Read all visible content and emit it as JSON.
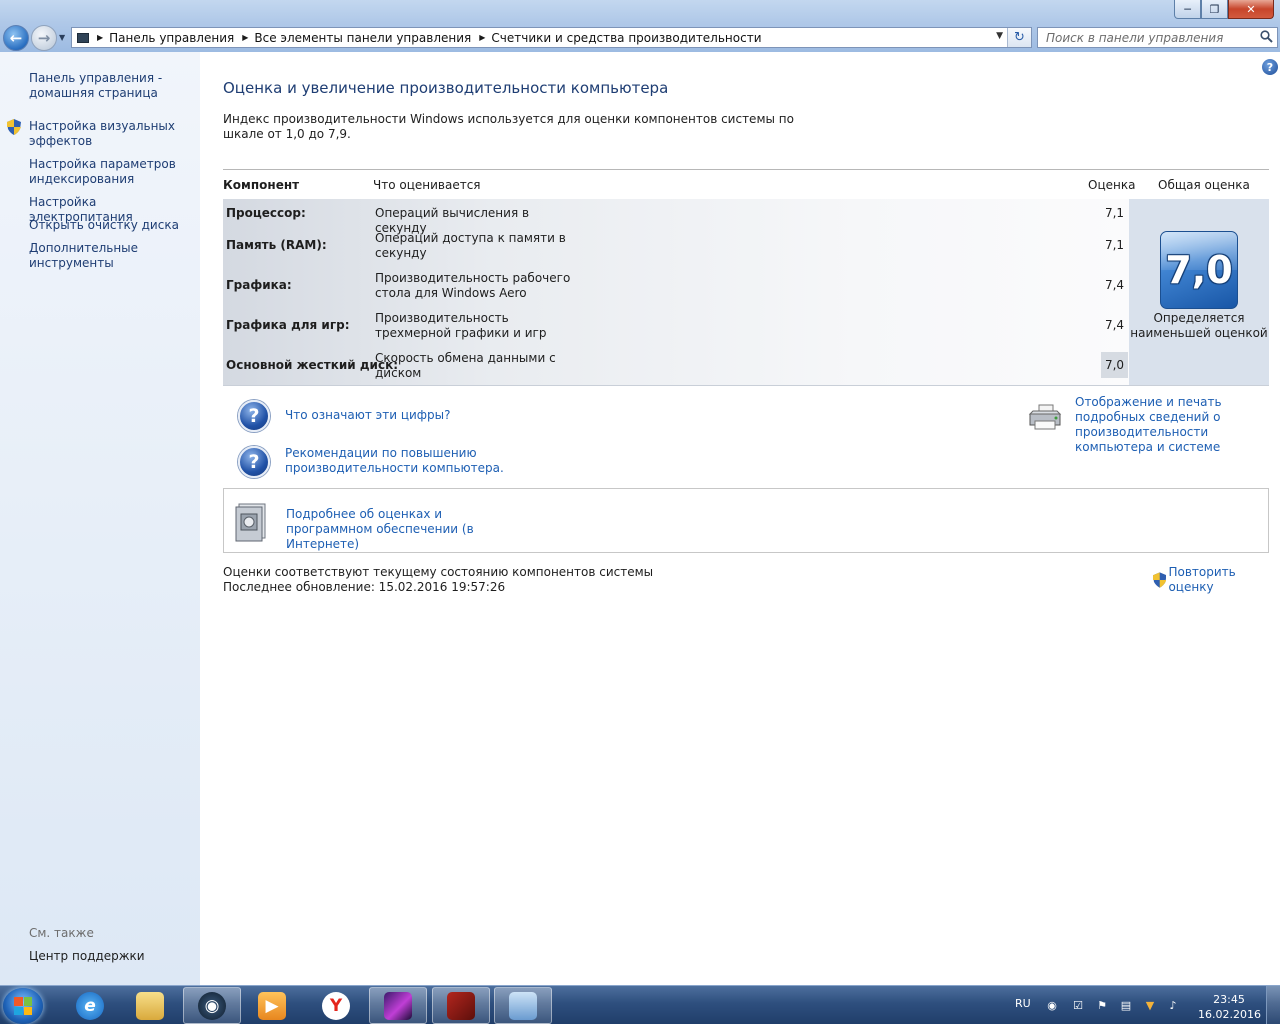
{
  "window": {
    "controls": {
      "minimize": "─",
      "maximize": "❐",
      "close": "✕"
    }
  },
  "address": {
    "crumbs": [
      "Панель управления",
      "Все элементы панели управления",
      "Счетчики и средства производительности"
    ],
    "search_placeholder": "Поиск в панели управления"
  },
  "sidebar": {
    "items": [
      {
        "label": "Панель управления - домашняя страница",
        "shield": false
      },
      {
        "label": "Настройка визуальных эффектов",
        "shield": true
      },
      {
        "label": "Настройка параметров индексирования",
        "shield": false
      },
      {
        "label": "Настройка электропитания",
        "shield": false
      },
      {
        "label": "Открыть очистку диска",
        "shield": false
      },
      {
        "label": "Дополнительные инструменты",
        "shield": false
      }
    ],
    "see_also": "См. также",
    "support_center": "Центр поддержки"
  },
  "main": {
    "title": "Оценка и увеличение производительности компьютера",
    "intro": "Индекс производительности Windows используется для оценки компонентов системы по шкале от 1,0 до 7,9.",
    "table": {
      "headers": {
        "component": "Компонент",
        "what": "Что оценивается",
        "score": "Оценка",
        "overall": "Общая оценка"
      },
      "rows": [
        {
          "component": "Процессор:",
          "what": "Операций вычисления в секунду",
          "score": "7,1"
        },
        {
          "component": "Память (RAM):",
          "what": "Операций доступа к памяти в секунду",
          "score": "7,1"
        },
        {
          "component": "Графика:",
          "what": "Производительность рабочего стола для Windows Aero",
          "score": "7,4"
        },
        {
          "component": "Графика для игр:",
          "what": "Производительность трехмерной графики и игр",
          "score": "7,4"
        },
        {
          "component": "Основной жесткий диск:",
          "what": "Скорость обмена данными с диском",
          "score": "7,0"
        }
      ],
      "overall_score": "7,0",
      "overall_caption": "Определяется наименьшей оценкой"
    },
    "links": {
      "what_numbers": "Что означают эти цифры?",
      "recommendations": "Рекомендации по повышению производительности компьютера.",
      "print_details": "Отображение и печать подробных сведений о производительности компьютера и системе",
      "more_info": "Подробнее об оценках и программном обеспечении (в Интернете)"
    },
    "status": {
      "current": "Оценки соответствуют текущему состоянию компонентов системы",
      "last_update": "Последнее обновление: 15.02.2016 19:57:26",
      "rerate": "Повторить оценку"
    }
  },
  "taskbar": {
    "apps": [
      "internet-explorer",
      "file-explorer",
      "steam",
      "media-player",
      "yandex-browser",
      "game-launcher",
      "dota-2",
      "performance-control-panel"
    ],
    "language": "RU",
    "time": "23:45",
    "date": "16.02.2016"
  },
  "colors": {
    "link": "#1e5fb3",
    "title": "#1e3d73",
    "taskbar": "#2e4f7e"
  }
}
